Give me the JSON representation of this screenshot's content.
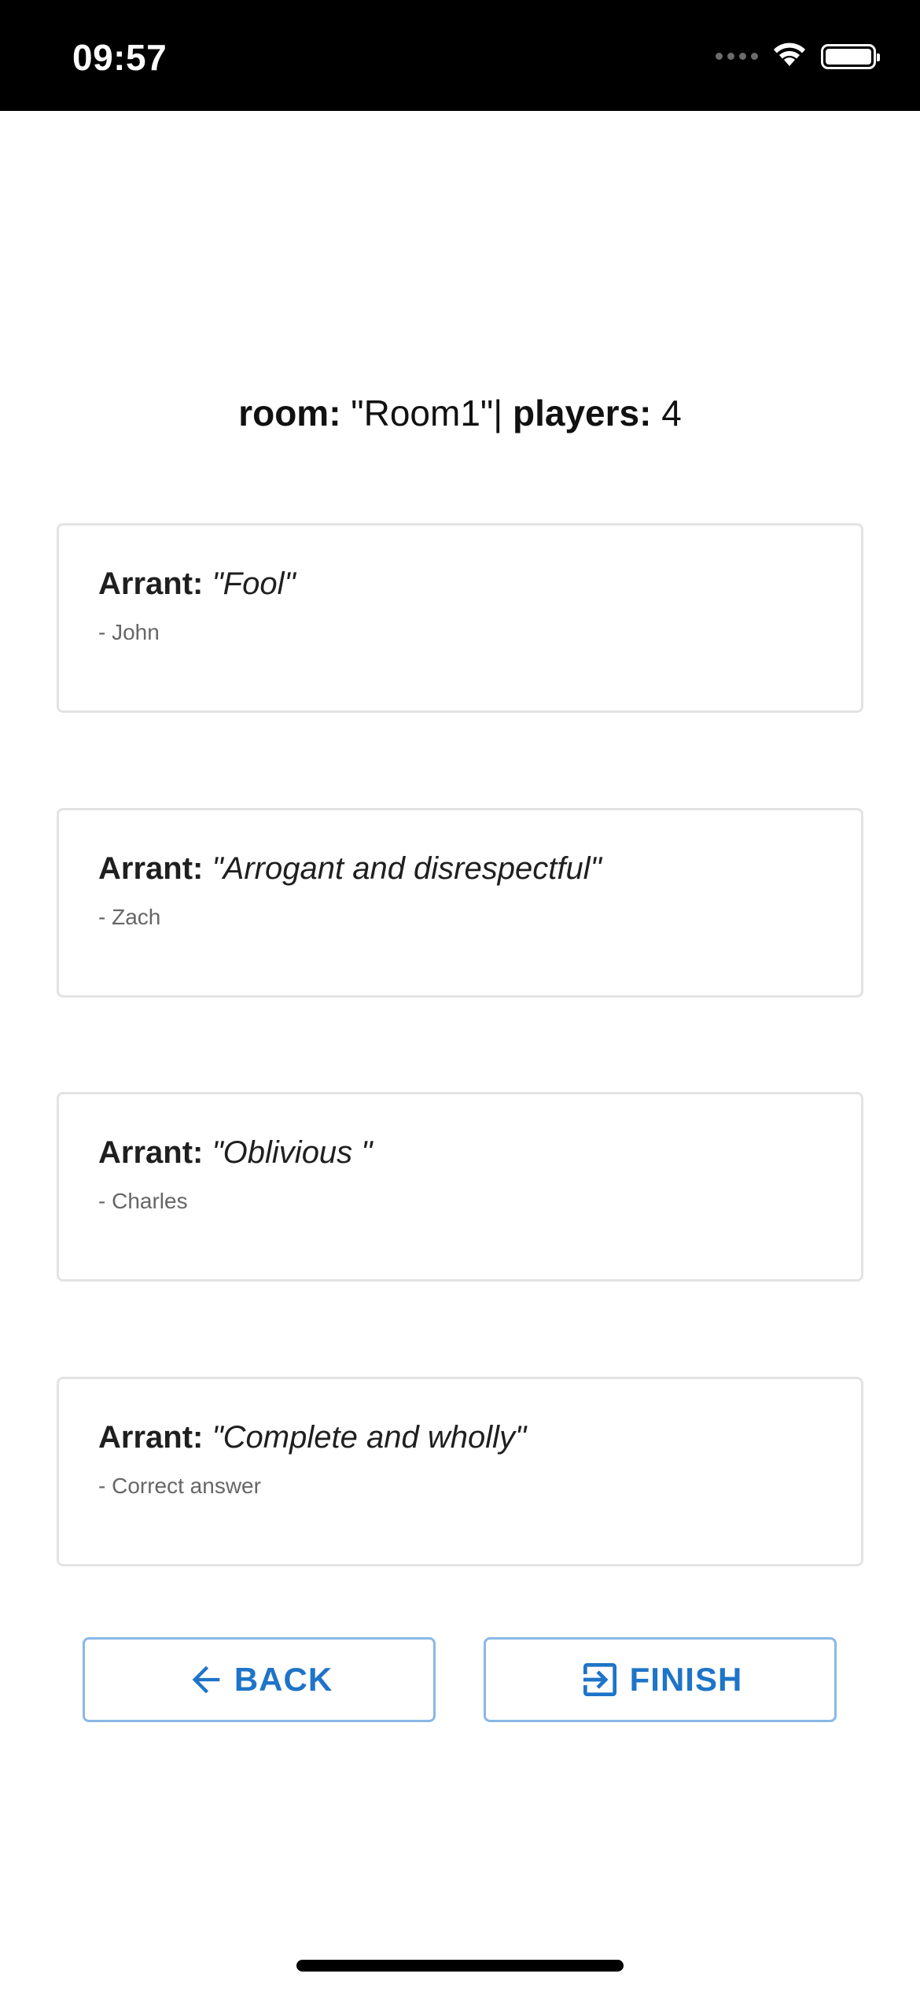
{
  "status_bar": {
    "time": "09:57",
    "icons": [
      "signal-dots-icon",
      "wifi-icon",
      "battery-icon"
    ]
  },
  "header": {
    "room_label": "room:",
    "room_value": " \"Room1\"| ",
    "players_label": "players:",
    "players_value": " 4"
  },
  "answers": [
    {
      "word": "Arrant:",
      "definition": "\"Fool\"",
      "author": "- John"
    },
    {
      "word": "Arrant:",
      "definition": "\"Arrogant and disrespectful\"",
      "author": "- Zach"
    },
    {
      "word": "Arrant:",
      "definition": "\"Oblivious \"",
      "author": "- Charles"
    },
    {
      "word": "Arrant:",
      "definition": "\"Complete and wholly\"",
      "author": "- Correct answer"
    }
  ],
  "buttons": {
    "back": {
      "label": "BACK",
      "icon": "arrow-left-icon"
    },
    "finish": {
      "label": "FINISH",
      "icon": "exit-to-app-icon"
    }
  },
  "colors": {
    "accent": "#1e74c8",
    "button_border": "#8ab8e6",
    "card_border": "#e3e3e3",
    "status_bar_bg": "#000000"
  }
}
